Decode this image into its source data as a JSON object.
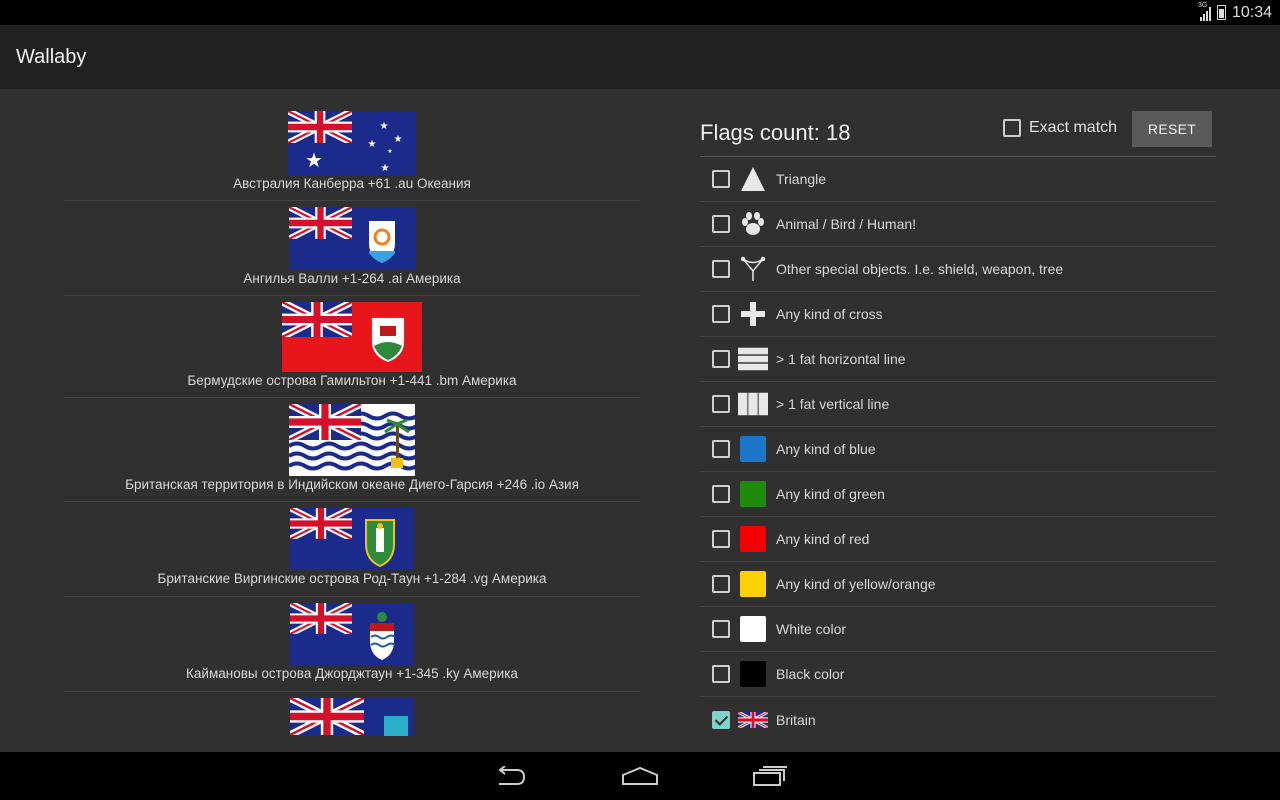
{
  "status_bar": {
    "network": "3G",
    "time": "10:34"
  },
  "app": {
    "title": "Wallaby"
  },
  "flags": [
    {
      "caption": "Австралия Канберра +61 .au Океания",
      "icon": "australia-flag"
    },
    {
      "caption": "Ангилья Валли +1-264 .ai Америка",
      "icon": "anguilla-flag"
    },
    {
      "caption": "Бермудские острова Гамильтон +1-441 .bm Америка",
      "icon": "bermuda-flag"
    },
    {
      "caption": "Британская территория в Индийском океане Диего-Гарсия +246 .io Азия",
      "icon": "biot-flag"
    },
    {
      "caption": "Британские Виргинские острова Род-Таун +1-284 .vg Америка",
      "icon": "bvi-flag"
    },
    {
      "caption": "Каймановы острова Джорджтаун +1-345 .ky Америка",
      "icon": "cayman-flag"
    }
  ],
  "panel": {
    "count_label": "Flags count:",
    "count_value": "18",
    "exact_match": "Exact match",
    "reset": "RESET"
  },
  "filters": [
    {
      "label": "Triangle",
      "icon": "triangle-icon",
      "checked": false
    },
    {
      "label": "Animal / Bird / Human!",
      "icon": "paw-icon",
      "checked": false
    },
    {
      "label": "Other special objects. I.e. shield, weapon, tree",
      "icon": "slingshot-icon",
      "checked": false
    },
    {
      "label": "Any kind of cross",
      "icon": "cross-icon",
      "checked": false
    },
    {
      "label": "> 1 fat horizontal line",
      "icon": "horizontal-lines-icon",
      "checked": false
    },
    {
      "label": "> 1 fat vertical line",
      "icon": "vertical-lines-icon",
      "checked": false
    },
    {
      "label": "Any kind of blue",
      "icon": "blue-swatch",
      "color": "#1976c8",
      "checked": false
    },
    {
      "label": "Any kind of green",
      "icon": "green-swatch",
      "color": "#1f8a0e",
      "checked": false
    },
    {
      "label": "Any kind of red",
      "icon": "red-swatch",
      "color": "#f40000",
      "checked": false
    },
    {
      "label": "Any kind of yellow/orange",
      "icon": "yellow-swatch",
      "color": "#ffd000",
      "checked": false
    },
    {
      "label": "White color",
      "icon": "white-swatch",
      "color": "#ffffff",
      "checked": false
    },
    {
      "label": "Black color",
      "icon": "black-swatch",
      "color": "#000000",
      "checked": false
    },
    {
      "label": "Britain",
      "icon": "britain-flag-icon",
      "checked": true
    }
  ],
  "nav": {
    "back": "back-icon",
    "home": "home-icon",
    "recents": "recents-icon"
  }
}
